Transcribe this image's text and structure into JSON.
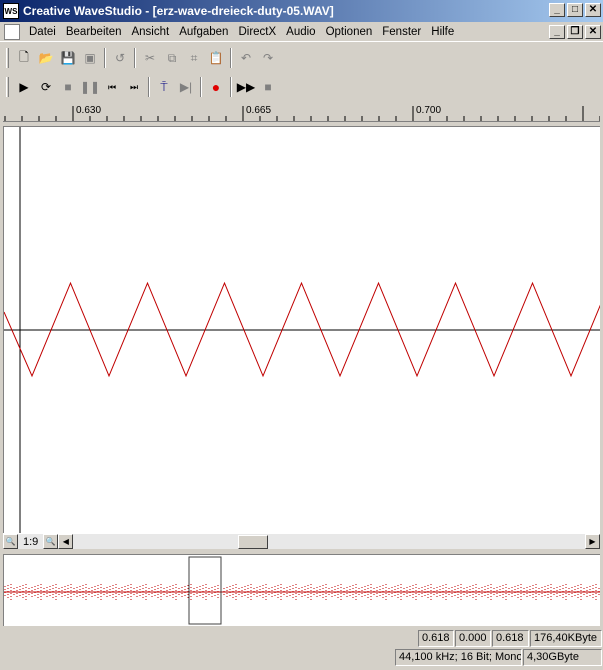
{
  "window": {
    "title": "Creative WaveStudio - [erz-wave-dreieck-duty-05.WAV]",
    "app_icon_label": "WS"
  },
  "menu": {
    "items": [
      "Datei",
      "Bearbeiten",
      "Ansicht",
      "Aufgaben",
      "DirectX",
      "Audio",
      "Optionen",
      "Fenster",
      "Hilfe"
    ]
  },
  "ruler": {
    "labels": [
      "0.630",
      "0.665",
      "0.700"
    ]
  },
  "zoom": {
    "ratio": "1:9"
  },
  "waveform": {
    "color": "#c00000",
    "shape": "triangle"
  },
  "status": {
    "values": [
      "0.618",
      "0.000",
      "0.618",
      "176,40KByte"
    ],
    "format": "44,100 kHz; 16 Bit; Mono",
    "disk": "4,30GByte"
  }
}
